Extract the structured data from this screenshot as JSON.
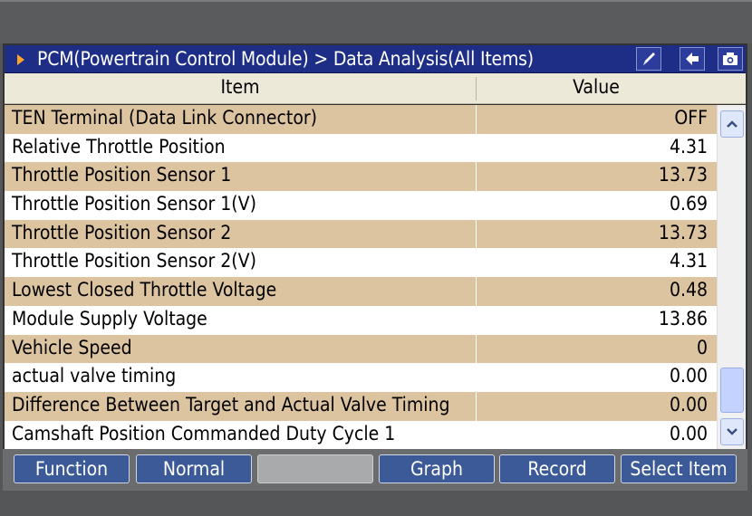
{
  "title": {
    "text": "PCM(Powertrain Control Module) > Data Analysis(All Items)",
    "icons": [
      "pen-icon",
      "back-arrow-icon",
      "camera-icon"
    ]
  },
  "header": {
    "item_label": "Item",
    "value_label": "Value"
  },
  "rows": [
    {
      "item": "TEN Terminal (Data Link Connector)",
      "value": "OFF"
    },
    {
      "item": "Relative Throttle Position",
      "value": "4.31"
    },
    {
      "item": "Throttle Position Sensor 1",
      "value": "13.73"
    },
    {
      "item": "Throttle Position Sensor 1(V)",
      "value": "0.69"
    },
    {
      "item": "Throttle Position Sensor 2",
      "value": "13.73"
    },
    {
      "item": "Throttle Position Sensor 2(V)",
      "value": "4.31"
    },
    {
      "item": "Lowest Closed Throttle Voltage",
      "value": "0.48"
    },
    {
      "item": "Module Supply Voltage",
      "value": "13.86"
    },
    {
      "item": "Vehicle Speed",
      "value": "0"
    },
    {
      "item": "actual valve timing",
      "value": "0.00"
    },
    {
      "item": "Difference Between Target and Actual Valve Timing",
      "value": "0.00"
    },
    {
      "item": "Camshaft Position Commanded Duty Cycle 1",
      "value": "0.00"
    }
  ],
  "buttons": {
    "function": "Function",
    "normal": "Normal",
    "blank": "",
    "graph": "Graph",
    "record": "Record",
    "select_item": "Select Item"
  },
  "colors": {
    "title_bg": "#1e2e86",
    "row_shade": "#ddc4a0",
    "button_bg": "#3c5a98"
  }
}
